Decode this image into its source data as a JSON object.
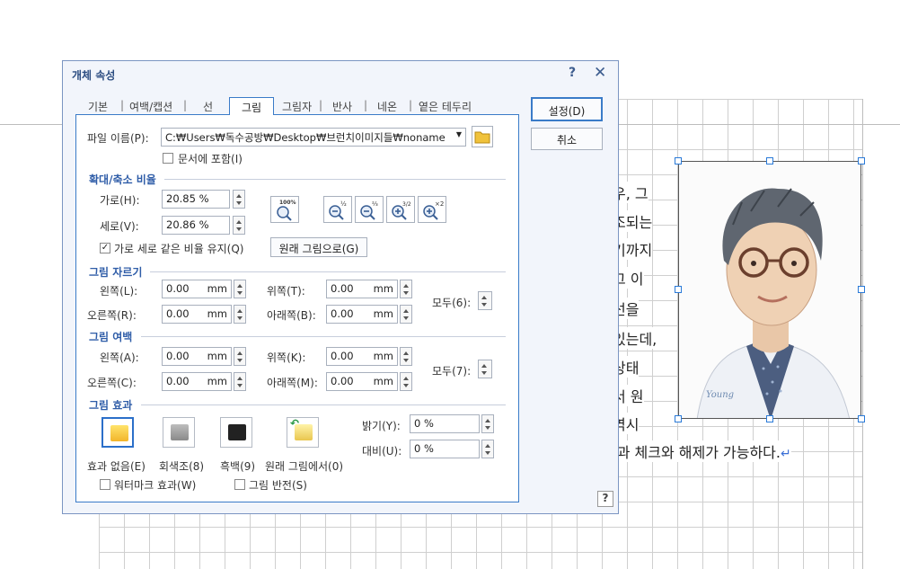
{
  "dialog": {
    "title": "개체 속성",
    "help_glyph": "?",
    "close_glyph": "✕",
    "tabs": [
      "기본",
      "여백/캡션",
      "선",
      "그림",
      "그림자",
      "반사",
      "네온",
      "옅은 테두리"
    ],
    "active_tab": "그림",
    "buttons": {
      "ok": "설정(D)",
      "cancel": "취소"
    },
    "bottom_help": "?"
  },
  "file": {
    "label": "파일 이름(P):",
    "value": "C:₩Users₩독수공방₩Desktop₩브런치이미지들₩noname",
    "include_label": "문서에 포함(I)",
    "include_checked": false
  },
  "scale": {
    "section": "확대/축소 비율",
    "width_label": "가로(H):",
    "width_value": "20.85 %",
    "height_label": "세로(V):",
    "height_value": "20.86 %",
    "keep_ratio_label": "가로 세로 같은 비율 유지(Q)",
    "keep_ratio_checked": true,
    "original_button": "원래 그림으로(G)",
    "zoom_icons": [
      "100%",
      "½",
      "⅔",
      "3/2",
      "×2"
    ]
  },
  "crop": {
    "section": "그림 자르기",
    "left_label": "왼쪽(L):",
    "left_value": "0.00",
    "right_label": "오른쪽(R):",
    "right_value": "0.00",
    "top_label": "위쪽(T):",
    "top_value": "0.00",
    "bottom_label": "아래쪽(B):",
    "bottom_value": "0.00",
    "all_label": "모두(6):",
    "unit": "mm"
  },
  "margin": {
    "section": "그림 여백",
    "left_label": "왼쪽(A):",
    "left_value": "0.00",
    "right_label": "오른쪽(C):",
    "right_value": "0.00",
    "top_label": "위쪽(K):",
    "top_value": "0.00",
    "bottom_label": "아래쪽(M):",
    "bottom_value": "0.00",
    "all_label": "모두(7):",
    "unit": "mm"
  },
  "effects": {
    "section": "그림 효과",
    "options": [
      "효과 없음(E)",
      "회색조(8)",
      "흑백(9)",
      "원래 그림에서(0)"
    ],
    "selected": "효과 없음(E)",
    "brightness_label": "밝기(Y):",
    "brightness_value": "0 %",
    "contrast_label": "대비(U):",
    "contrast_value": "0 %",
    "watermark_label": "워터마크 효과(W)",
    "invert_label": "그림 반전(S)"
  },
  "document": {
    "lines": [
      "우, 그",
      "조되는",
      "기까지",
      "그 이",
      "선을",
      "있는데,",
      "상태",
      "서 원",
      "역시",
      "음과 체크와 해제가 가능하다."
    ],
    "picture_signature": "Young"
  },
  "colors": {
    "accent": "#2f5da8",
    "dialog_bg": "#f2f5fb",
    "border": "#3a7bc8"
  }
}
